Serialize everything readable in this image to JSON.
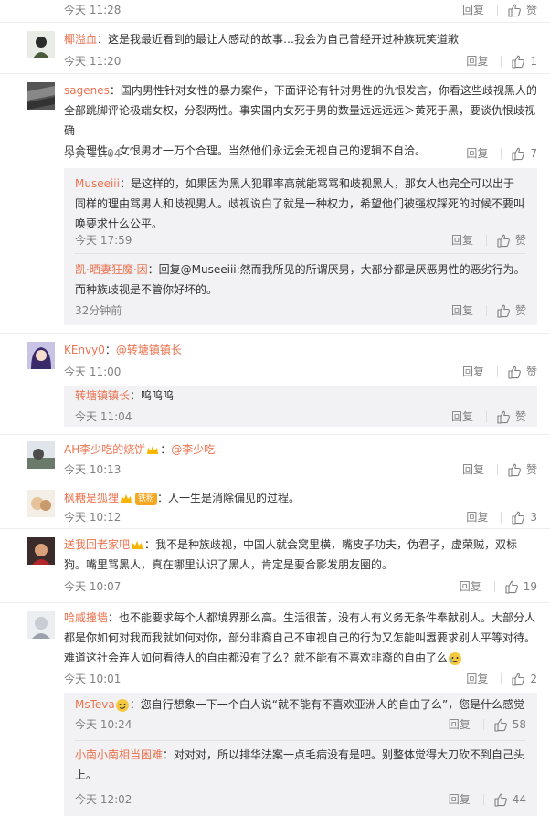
{
  "actions": {
    "reply": "回复",
    "like_placeholder": "赞"
  },
  "top_partial": {
    "time": "今天 11:28",
    "like": "赞"
  },
  "comments": [
    {
      "user": "椰溢血",
      "text": "：这是我最近看到的最让人感动的故事…我会为自己曾经开过种族玩笑道歉",
      "time": "今天 11:20",
      "likes": "1"
    },
    {
      "user": "sagenes",
      "text_lines": [
        "：国内男性针对女性的暴力案件，下面评论有针对男性的仇恨发言，你看这些歧视黑人的",
        "全部跳脚评论极端女权，分裂两性。事实国内女死于男的数量远远远远＞黄死于黑，要谈仇恨歧视确",
        "见合理性，女恨男才一万个合理。当然他们永远会无视自己的逻辑不自洽。"
      ],
      "time": "今天 11:04",
      "likes": "7",
      "replies": [
        {
          "user": "Museeiii",
          "text_lines": [
            "：是这样的，如果因为黑人犯罪率高就能骂骂和歧视黑人，那女人也完全可以出于",
            "同样的理由骂男人和歧视男人。歧视说白了就是一种权力，希望他们被强权踩死的时候不要叫",
            "唤要求什么公平。"
          ],
          "time": "今天 17:59",
          "likes": "赞"
        },
        {
          "user": "凯·晒妻狂魔·因",
          "text_lines": [
            "：回复@Museeiii:然而我所见的所谓厌男，大部分都是厌恶男性的恶劣行为。",
            "而种族歧视是不管你好坏的。"
          ],
          "mention": "@Museeiii",
          "time": "32分钟前",
          "likes": "赞"
        }
      ]
    },
    {
      "user": "KEnvy0",
      "text_prefix": "：",
      "mention": "@转塘镇镇长",
      "time": "今天 11:00",
      "likes": "赞",
      "replies": [
        {
          "user": "转塘镇镇长",
          "text": "：呜呜呜",
          "time": "今天 11:04",
          "likes": "赞"
        }
      ]
    },
    {
      "user": "AH李少吃的烧饼",
      "text_prefix": "：",
      "mention": "@李少吃",
      "time": "今天 10:13",
      "likes": "赞"
    },
    {
      "user": "枫糖是狐狸",
      "badge": "铁粉",
      "text": "：人一生是消除偏见的过程。",
      "time": "今天 10:12",
      "likes": "3"
    },
    {
      "user": "送我回老家吧",
      "text_lines": [
        "：我不是种族歧视，中国人就会窝里横，嘴皮子功夫，伪君子，虚荣贼，双标",
        "狗。嘴里骂黑人，真在哪里认识了黑人，肯定是要合影发朋友圈的。"
      ],
      "time": "今天 10:07",
      "likes": "19"
    },
    {
      "user": "哈威撞墙",
      "text_lines": [
        "：也不能要求每个人都境界那么高。生活很苦，没有人有义务无条件奉献别人。大部分人",
        "都是你如何对我而我就如何对你，部分非裔自己不审视自己的行为又怎能叫嚣要求别人平等对待。",
        "难道这社会连人如何看待人的自由都没有了么？就不能有不喜欢非裔的自由了么"
      ],
      "time": "今天 10:01",
      "likes": "2",
      "replies": [
        {
          "user": "MsTeva",
          "text": "：您自行想象一下一个白人说“就不能有不喜欢亚洲人的自由了么”，您是什么感觉",
          "time": "今天 10:24",
          "likes": "58"
        },
        {
          "user": "小南小南相当困难",
          "text_lines": [
            "：对对对，所以排华法案一点毛病没有是吧。别整体觉得大刀砍不到自己头",
            "上。"
          ],
          "time": "今天 12:02",
          "likes": "44"
        }
      ]
    }
  ],
  "colors": {
    "username": "#eb7350",
    "meta": "#808080",
    "reply_bg": "#f2f2f5"
  }
}
